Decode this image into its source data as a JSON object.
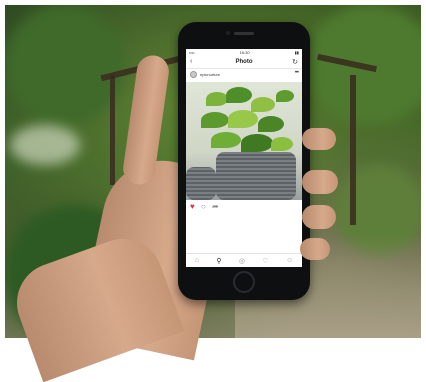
{
  "status_bar": {
    "carrier": "•••• ",
    "time": "16:30",
    "battery": "▮▮"
  },
  "nav": {
    "title": "Photo"
  },
  "post": {
    "username": "epicnurture"
  },
  "icons": {
    "back": "back-icon",
    "refresh": "refresh-icon",
    "more": "more-icon",
    "like": "heart-icon",
    "comment": "comment-icon",
    "share": "share-icon",
    "tab_home": "home-icon",
    "tab_search": "search-icon",
    "tab_camera": "camera-icon",
    "tab_activity": "heart-outline-icon",
    "tab_profile": "profile-icon"
  },
  "colors": {
    "like": "#e0314b",
    "phone_body": "#0e0f11",
    "foliage": "#3f5f2a"
  }
}
